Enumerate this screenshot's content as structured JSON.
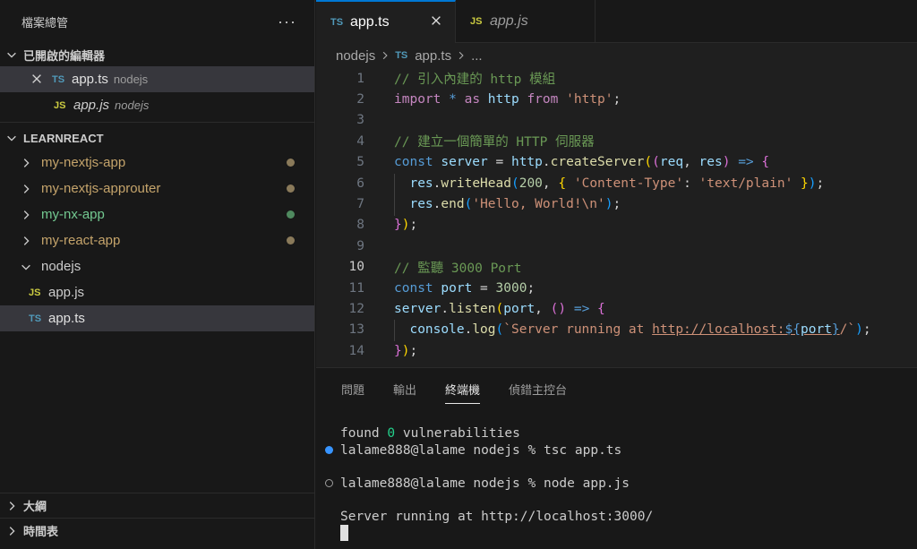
{
  "sidebar": {
    "title": "檔案總管",
    "more": "···",
    "open_editors": {
      "label": "已開啟的編輯器",
      "items": [
        {
          "badge": "TS",
          "name": "app.ts",
          "desc": "nodejs"
        },
        {
          "badge": "JS",
          "name": "app.js",
          "desc": "nodejs"
        }
      ]
    },
    "workspace": {
      "label": "LEARNREACT",
      "folders": [
        {
          "name": "my-nextjs-app",
          "color": "#c5a46b",
          "dot": "#8a7a5a"
        },
        {
          "name": "my-nextjs-approuter",
          "color": "#c5a46b",
          "dot": "#8a7a5a"
        },
        {
          "name": "my-nx-app",
          "color": "#73c991",
          "dot": "#4f8a5f"
        },
        {
          "name": "my-react-app",
          "color": "#c5a46b",
          "dot": "#8a7a5a"
        },
        {
          "name": "nodejs",
          "color": "#cccccc"
        }
      ],
      "files": [
        {
          "badge": "JS",
          "name": "app.js"
        },
        {
          "badge": "TS",
          "name": "app.ts"
        }
      ]
    },
    "outline": "大綱",
    "timeline": "時間表"
  },
  "editor": {
    "tabs": [
      {
        "badge": "TS",
        "name": "app.ts"
      },
      {
        "badge": "JS",
        "name": "app.js"
      }
    ],
    "breadcrumb": {
      "folder": "nodejs",
      "badge": "TS",
      "file": "app.ts",
      "more": "..."
    },
    "line_numbers": [
      "1",
      "2",
      "3",
      "4",
      "5",
      "6",
      "7",
      "8",
      "9",
      "10",
      "11",
      "12",
      "13",
      "14"
    ],
    "code": {
      "l1": "// 引入內建的 http 模組",
      "l2": {
        "import": "import",
        "star": " * ",
        "as": "as",
        "name": " http ",
        "from": "from",
        "str": " 'http'",
        "semi": ";"
      },
      "l4": "// 建立一個簡單的 HTTP 伺服器",
      "l5": {
        "const": "const",
        "var": " server ",
        "eq": "= ",
        "obj": "http",
        "dot": ".",
        "fn": "createServer",
        "p1": "(",
        "p2": "(",
        "a1": "req",
        "comma": ", ",
        "a2": "res",
        "p3": ")",
        "arrow": " => ",
        "b": "{"
      },
      "l6": {
        "obj": "res",
        "dot": ".",
        "fn": "writeHead",
        "p": "(",
        "num": "200",
        "comma": ", ",
        "b1": "{ ",
        "k": "'Content-Type'",
        "colon": ": ",
        "v": "'text/plain'",
        "b2": " }",
        "p2": ")",
        "semi": ";"
      },
      "l7": {
        "obj": "res",
        "dot": ".",
        "fn": "end",
        "p": "(",
        "str": "'Hello, World!\\n'",
        "p2": ")",
        "semi": ";"
      },
      "l8": {
        "b": "}",
        "p": ")",
        "semi": ";"
      },
      "l10": "// 監聽 3000 Port",
      "l11": {
        "const": "const",
        "var": " port ",
        "eq": "= ",
        "num": "3000",
        "semi": ";"
      },
      "l12": {
        "obj": "server",
        "dot": ".",
        "fn": "listen",
        "p": "(",
        "arg": "port",
        "comma": ", ",
        "p2": "()",
        "arrow": " => ",
        "b": "{"
      },
      "l13": {
        "obj": "console",
        "dot": ".",
        "fn": "log",
        "p": "(",
        "s1": "`Server running at ",
        "link": "http://localhost:",
        "t1": "${",
        "tv": "port",
        "t2": "}",
        "s2": "/`",
        "p2": ")",
        "semi": ";"
      },
      "l14": {
        "b": "}",
        "p": ")",
        "semi": ";"
      }
    }
  },
  "panel": {
    "tabs": [
      "問題",
      "輸出",
      "終端機",
      "偵錯主控台"
    ],
    "active_tab": "終端機",
    "terminal": {
      "l1a": "found ",
      "l1b": "0",
      "l1c": " vulnerabilities",
      "l2": "lalame888@lalame nodejs % tsc app.ts",
      "l3": "lalame888@lalame nodejs % node app.js",
      "l4": "Server running at http://localhost:3000/"
    }
  }
}
